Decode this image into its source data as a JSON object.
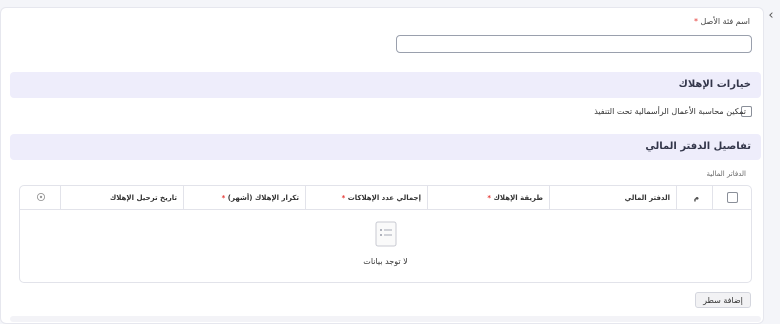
{
  "asset_category": {
    "label": "اسم فئة الأصل",
    "required_mark": "*",
    "value": ""
  },
  "depreciation_options": {
    "title": "خيارات الإهلاك",
    "enable_cwip_label": "تمكين محاسبة الأعمال الرأسمالية تحت التنفيذ",
    "enable_cwip_checked": false
  },
  "finance_book_details": {
    "title": "تفاصيل الدفتر المالي",
    "table_label": "الدفاتر المالية",
    "columns": {
      "no": "م",
      "finance_book": "الدفتر المالي",
      "depreciation_method": "طريقة الإهلاك",
      "total_depreciations": "إجمالي عدد الإهلاكات",
      "frequency": "تكرار الإهلاك (أشهر)",
      "posting_date": "تاريخ ترحيل الإهلاك"
    },
    "required_mark": "*",
    "empty_message": "لا توجد بيانات",
    "add_row_label": "إضافة سطر"
  },
  "icons": {
    "collapse": "chevron-left-icon",
    "settings": "gear-icon",
    "empty": "document-icon"
  },
  "colors": {
    "section_bg": "#eeedfb",
    "required": "#e53935"
  }
}
